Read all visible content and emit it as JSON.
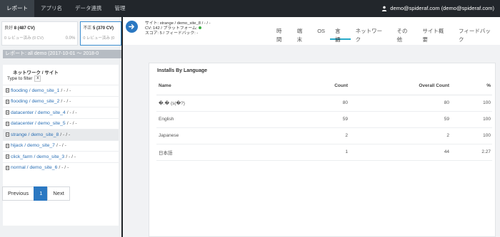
{
  "navbar": {
    "items": [
      "レポート",
      "アプリ名",
      "データ連携",
      "管理"
    ],
    "user": "demo@spideraf.com (demo@spideraf.com)"
  },
  "summary": {
    "card1_title": "良好",
    "card1_value": "8 (487 CV)",
    "card1_sub": "0 レビュー済み (0 CV)",
    "card1_pct": "0.0%",
    "card2_title": "不正",
    "card2_value": "5 (370 CV)",
    "card2_sub": "0 レビュー済み (0"
  },
  "report_bar": "レポート: all demo (2017-10-01 ～ 2018-0",
  "site_panel": {
    "header": "ネットワーク / サイト",
    "filter_label": "Type to filter",
    "filter_clear": "x",
    "items": [
      {
        "link": "flooding / demo_site_1",
        "rest": " / - / -"
      },
      {
        "link": "flooding / demo_site_2",
        "rest": " / - / -"
      },
      {
        "link": "datacenter / demo_site_4",
        "rest": " / - / -"
      },
      {
        "link": "datacenter / demo_site_5",
        "rest": " / - / -"
      },
      {
        "link": "strange / demo_site_8",
        "rest": " / - / -"
      },
      {
        "link": "hijack / demo_site_7",
        "rest": " / - / -"
      },
      {
        "link": "click_farm / demo_site_3",
        "rest": " / - / -"
      },
      {
        "link": "normal / demo_site_6",
        "rest": " / - / -"
      }
    ]
  },
  "pager": {
    "previous": "Previous",
    "page": "1",
    "next": "Next"
  },
  "info": {
    "site": "サイト: strange / demo_site_8 / - / -",
    "cv": "CV: 142 / プラットフォーム:",
    "score": "スコア: 5 / フィードバック: -"
  },
  "tabs": [
    "時間",
    "端末",
    "OS",
    "言語",
    "ネットワーク",
    "その他",
    "サイト概要",
    "フィードバック"
  ],
  "table": {
    "title": "Installs By Language",
    "headers": {
      "name": "Name",
      "count": "Count",
      "overall": "Overall Count",
      "pct": "%"
    },
    "rows": [
      {
        "name": "�.� (s(�?)",
        "count": "80",
        "overall": "80",
        "pct": "100"
      },
      {
        "name": "English",
        "count": "59",
        "overall": "59",
        "pct": "100"
      },
      {
        "name": "Japanese",
        "count": "2",
        "overall": "2",
        "pct": "100"
      },
      {
        "name": "日本語",
        "count": "1",
        "overall": "44",
        "pct": "2.27"
      }
    ]
  },
  "colors": {
    "navbar": "#22262b",
    "accent": "#2b78c2",
    "tab_underline": "#27a9c9",
    "status_green": "#3cb043"
  }
}
